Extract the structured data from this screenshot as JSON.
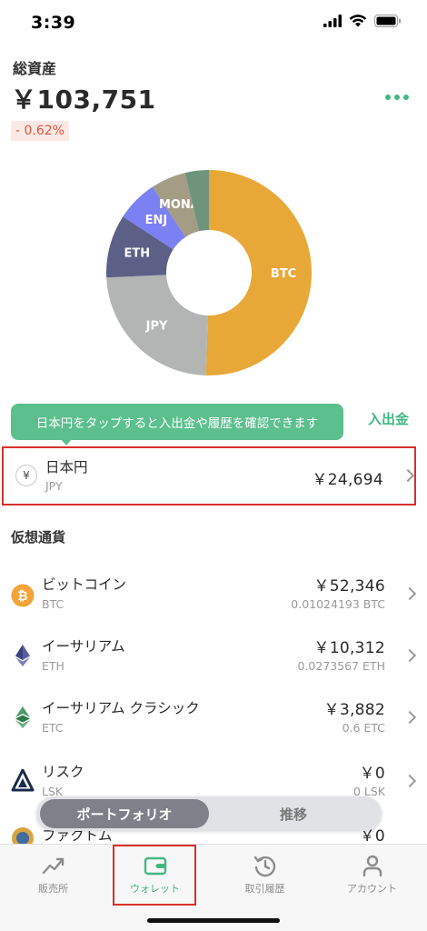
{
  "status": {
    "time": "3:39"
  },
  "summary": {
    "label": "総資産",
    "total": "￥103,751",
    "change": "- 0.62%"
  },
  "chart_data": {
    "type": "pie",
    "style": "donut",
    "categories": [
      "BTC",
      "JPY",
      "ETH",
      "ENJ",
      "MONA",
      "Other"
    ],
    "values": [
      52346,
      24694,
      10312,
      6800,
      5700,
      3899
    ],
    "colors": [
      "#e8a838",
      "#b2b5b3",
      "#5c5f86",
      "#7b80f2",
      "#a59c86",
      "#6e947c"
    ],
    "labels_shown": [
      "BTC",
      "JPY",
      "ETH",
      "ENJ",
      "MONA",
      ""
    ]
  },
  "tooltip": {
    "text": "日本円をタップすると入出金や履歴を確認できます"
  },
  "deposit": {
    "label": "入出金"
  },
  "jpy": {
    "icon": "¥",
    "name": "日本円",
    "symbol": "JPY",
    "value": "￥24,694"
  },
  "crypto": {
    "title": "仮想通貨",
    "items": [
      {
        "name": "ビットコイン",
        "symbol": "BTC",
        "value": "￥52,346",
        "amount": "0.01024193 BTC",
        "icon": "bitcoin-icon"
      },
      {
        "name": "イーサリアム",
        "symbol": "ETH",
        "value": "￥10,312",
        "amount": "0.0273567 ETH",
        "icon": "ethereum-icon"
      },
      {
        "name": "イーサリアム クラシック",
        "symbol": "ETC",
        "value": "￥3,882",
        "amount": "0.6 ETC",
        "icon": "ethereum-classic-icon"
      },
      {
        "name": "リスク",
        "symbol": "LSK",
        "value": "￥0",
        "amount": "0 LSK",
        "icon": "lisk-icon"
      },
      {
        "name": "ファクトム",
        "symbol": "",
        "value": "￥0",
        "amount": "",
        "icon": "factom-icon"
      }
    ]
  },
  "toggle": {
    "active": "ポートフォリオ",
    "inactive": "推移"
  },
  "tabs": [
    {
      "label": "販売所",
      "icon": "chart-trend-icon"
    },
    {
      "label": "ウォレット",
      "icon": "wallet-icon"
    },
    {
      "label": "取引履歴",
      "icon": "history-icon"
    },
    {
      "label": "アカウント",
      "icon": "account-icon"
    }
  ],
  "colors": {
    "accent": "#41b883",
    "highlight_border": "#d9302a",
    "negative": "#e0553d"
  }
}
